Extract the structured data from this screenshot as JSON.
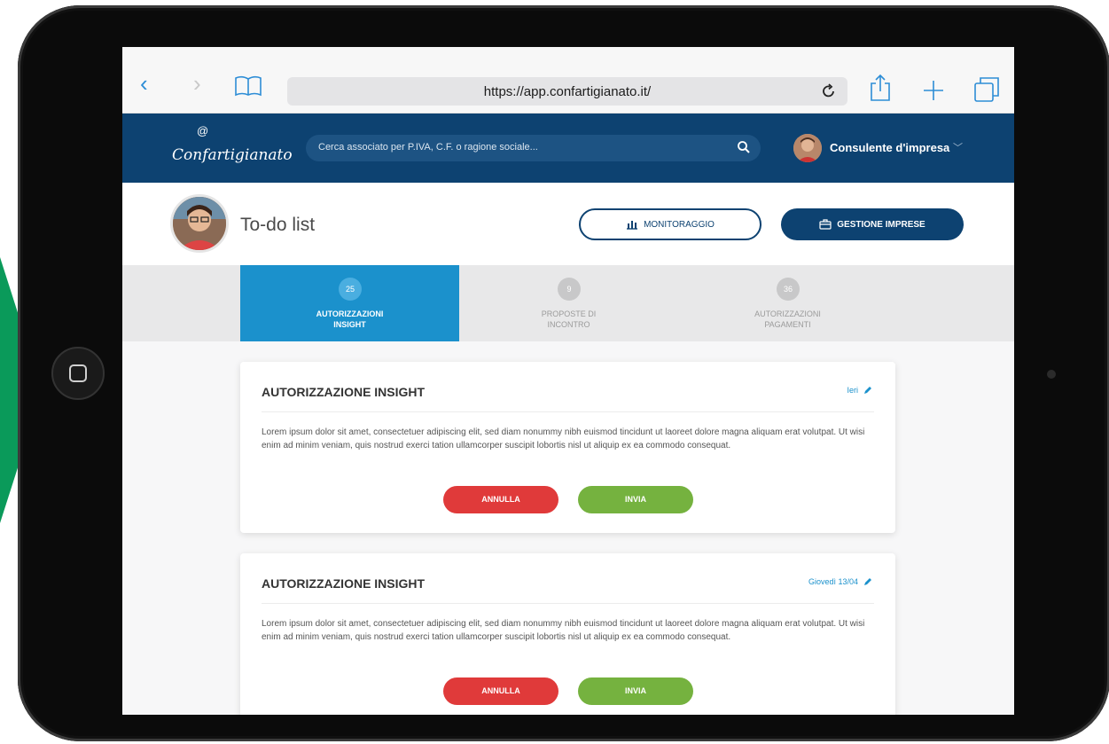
{
  "browser": {
    "url": "https://app.confartigianato.it/"
  },
  "header": {
    "logo_text": "Confartigianato",
    "search_placeholder": "Cerca associato per P.IVA, C.F. o ragione sociale...",
    "user_name": "Consulente d'impresa"
  },
  "page": {
    "title": "To-do list",
    "monitor_label": "MONITORAGGIO",
    "gestione_label": "GESTIONE IMPRESE"
  },
  "tabs": [
    {
      "count": "25",
      "label_1": "AUTORIZZAZIONI",
      "label_2": "INSIGHT",
      "active": true
    },
    {
      "count": "9",
      "label_1": "PROPOSTE DI",
      "label_2": "INCONTRO",
      "active": false
    },
    {
      "count": "36",
      "label_1": "AUTORIZZAZIONI",
      "label_2": "PAGAMENTI",
      "active": false
    }
  ],
  "cards": [
    {
      "title": "AUTORIZZAZIONE INSIGHT",
      "date": "Ieri",
      "text": "Lorem ipsum dolor sit amet, consectetuer adipiscing elit, sed diam nonummy nibh euismod tincidunt ut laoreet dolore magna aliquam erat volutpat. Ut wisi enim ad minim veniam, quis nostrud exerci tation ullamcorper suscipit lobortis nisl ut aliquip ex ea commodo consequat.",
      "cancel_label": "ANNULLA",
      "send_label": "INVIA"
    },
    {
      "title": "AUTORIZZAZIONE INSIGHT",
      "date": "Giovedì 13/04",
      "text": "Lorem ipsum dolor sit amet, consectetuer adipiscing elit, sed diam nonummy nibh euismod tincidunt ut laoreet dolore magna aliquam erat volutpat. Ut wisi enim ad minim veniam, quis nostrud exerci tation ullamcorper suscipit lobortis nisl ut aliquip ex ea commodo consequat.",
      "cancel_label": "ANNULLA",
      "send_label": "INVIA"
    }
  ],
  "colors": {
    "header_bg": "#0d4271",
    "tab_active": "#1b91cc",
    "cancel": "#e03a3a",
    "send": "#75b23f",
    "side_shape": "#0a9a5a"
  }
}
